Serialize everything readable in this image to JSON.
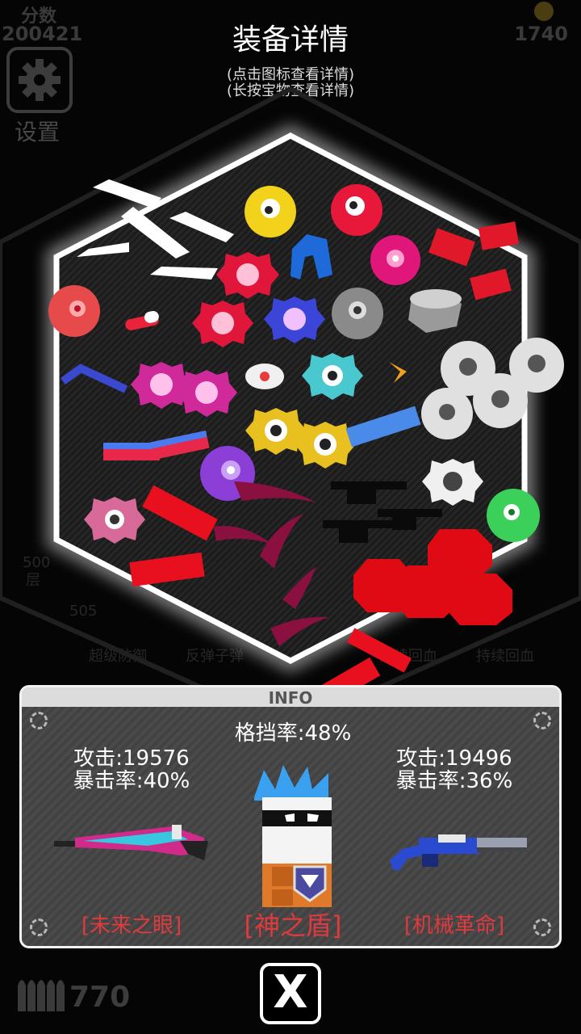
{
  "hud": {
    "score_label": "分数",
    "score_value": "200421",
    "coin_value": "1740",
    "settings_label": "设置",
    "ammo_value": "770",
    "close_label": "X"
  },
  "header": {
    "title": "装备详情",
    "hint_tap": "(点击图标查看详情)",
    "hint_hold": "(长按宝物查看详情)"
  },
  "background_text": {
    "floor_500": "500",
    "floor_unit": "层",
    "floor_505": "505",
    "skill_1": "超级防御",
    "skill_2": "反弹子弹",
    "skill_3": "持续回血",
    "skill_4": "持续回血"
  },
  "info": {
    "header_label": "INFO",
    "block_rate": "格挡率:48%",
    "left_weapon": {
      "attack": "攻击:19576",
      "crit": "暴击率:40%",
      "name": "[未来之眼]"
    },
    "center_item": {
      "name": "[神之盾]"
    },
    "right_weapon": {
      "attack": "攻击:19496",
      "crit": "暴击率:36%",
      "name": "[机械革命]"
    }
  },
  "colors": {
    "accent_red": "#e0393e",
    "hexagon_glow": "#ffffff",
    "panel_bg": "#474747"
  }
}
